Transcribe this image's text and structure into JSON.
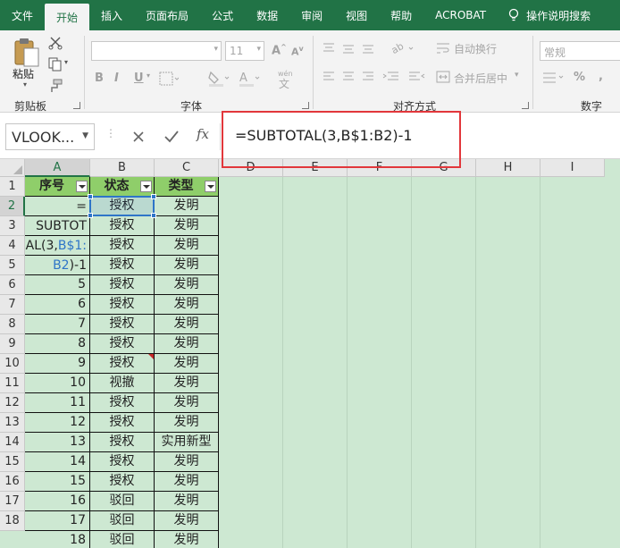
{
  "ribbon_tabs": [
    "文件",
    "开始",
    "插入",
    "页面布局",
    "公式",
    "数据",
    "审阅",
    "视图",
    "帮助",
    "ACROBAT"
  ],
  "tell_me": "操作说明搜索",
  "ribbon": {
    "paste_label": "粘贴",
    "font_name": "",
    "font_size": "11",
    "wrap_text": "自动换行",
    "merge_center": "合并后居中",
    "number_format": "常规",
    "groups": {
      "clipboard": "剪贴板",
      "font": "字体",
      "alignment": "对齐方式",
      "number": "数字"
    }
  },
  "formula_bar": {
    "name_box": "VLOOK...",
    "formula": "=SUBTOTAL(3,B$1:B2)-1"
  },
  "columns": [
    "A",
    "B",
    "C",
    "D",
    "E",
    "F",
    "G",
    "H",
    "I"
  ],
  "rows": [
    "1",
    "2",
    "3",
    "4",
    "5",
    "6",
    "7",
    "8",
    "9",
    "10",
    "11",
    "12",
    "13",
    "14",
    "15",
    "16",
    "17",
    "18"
  ],
  "table": {
    "headers": [
      "序号",
      "状态",
      "类型"
    ],
    "editing_a": [
      "=",
      "SUBTOT",
      "AL(3,",
      "B$1:",
      "B2)-1"
    ],
    "a_values": [
      "5",
      "6",
      "7",
      "8",
      "9",
      "10",
      "11",
      "12",
      "13",
      "14",
      "15",
      "16",
      "17",
      "18"
    ],
    "b_values": [
      "授权",
      "授权",
      "授权",
      "授权",
      "授权",
      "授权",
      "授权",
      "授权",
      "授权",
      "视撤",
      "授权",
      "授权",
      "授权",
      "授权",
      "授权",
      "驳回",
      "驳回",
      "驳回"
    ],
    "c_values": [
      "发明",
      "发明",
      "发明",
      "发明",
      "发明",
      "发明",
      "发明",
      "发明",
      "发明",
      "发明",
      "发明",
      "发明",
      "实用新型",
      "发明",
      "发明",
      "发明",
      "发明",
      "发明"
    ]
  },
  "colors": {
    "excel_green": "#217346",
    "header_fill": "#8fce6a",
    "sheet_bg": "#cde8d2",
    "annotation_red": "#e2373b",
    "ref_blue": "#2e75c8"
  }
}
